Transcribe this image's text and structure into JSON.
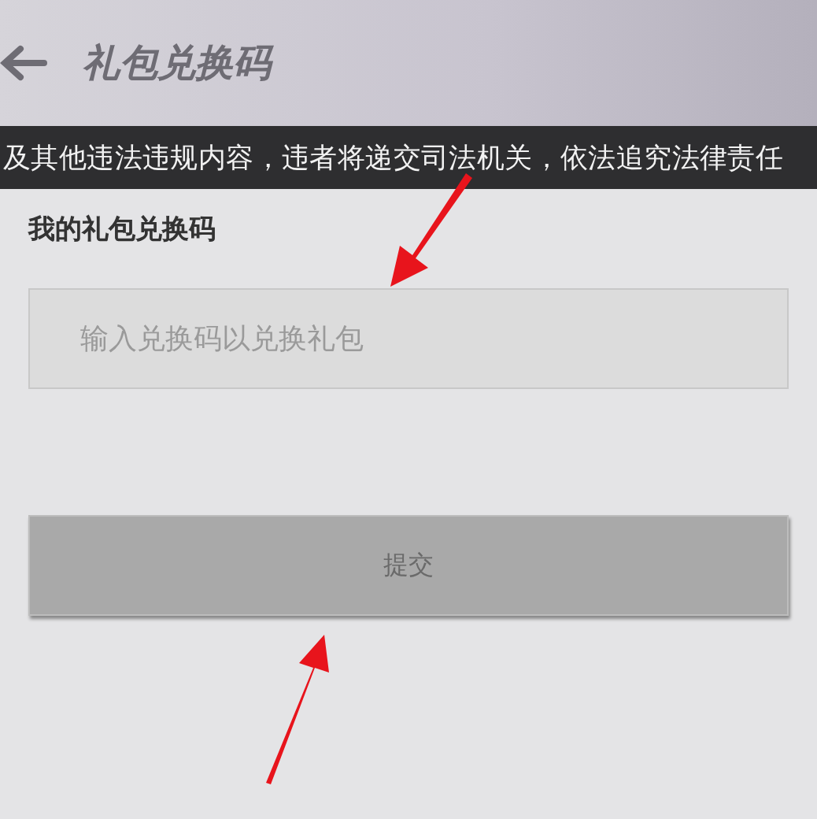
{
  "header": {
    "title": "礼包兑换码"
  },
  "notice": {
    "text": "及其他违法违规内容，违者将递交司法机关，依法追究法律责任"
  },
  "form": {
    "label": "我的礼包兑换码",
    "placeholder": "输入兑换码以兑换礼包",
    "submit": {
      "label": "提交",
      "disabled": true
    }
  }
}
